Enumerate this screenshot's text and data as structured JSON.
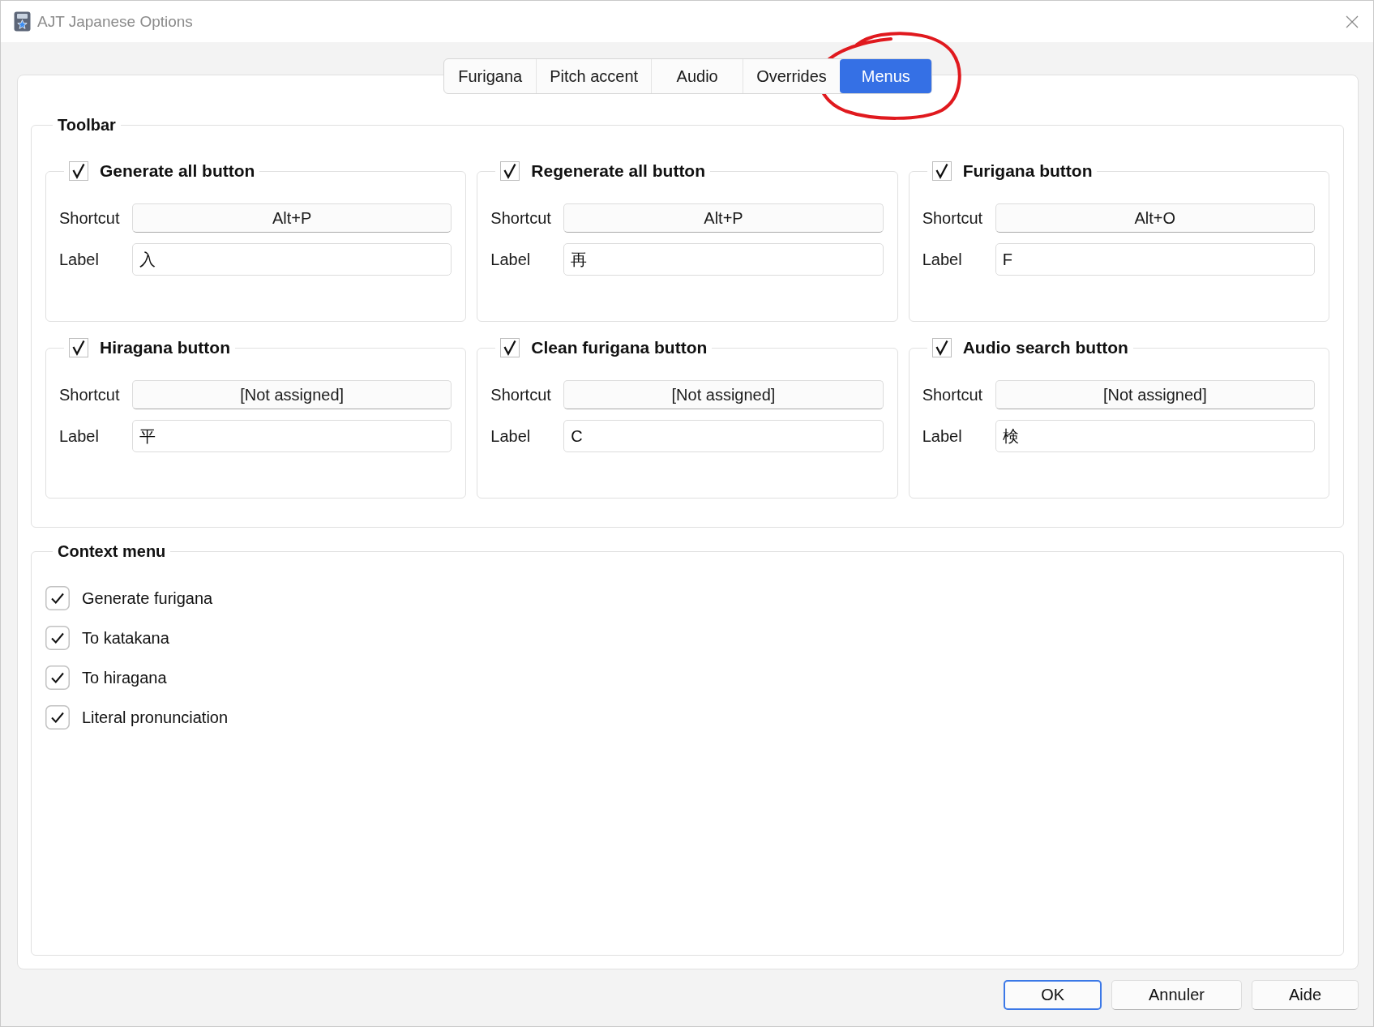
{
  "window": {
    "title": "AJT Japanese Options"
  },
  "tabs": [
    {
      "label": "Furigana",
      "selected": false
    },
    {
      "label": "Pitch accent",
      "selected": false
    },
    {
      "label": "Audio",
      "selected": false
    },
    {
      "label": "Overrides",
      "selected": false
    },
    {
      "label": "Menus",
      "selected": true
    }
  ],
  "toolbar": {
    "title": "Toolbar",
    "buttons": [
      {
        "title": "Generate all button",
        "checked": true,
        "shortcut_caption": "Shortcut",
        "shortcut": "Alt+P",
        "label_caption": "Label",
        "label": "入"
      },
      {
        "title": "Regenerate all button",
        "checked": true,
        "shortcut_caption": "Shortcut",
        "shortcut": "Alt+P",
        "label_caption": "Label",
        "label": "再"
      },
      {
        "title": "Furigana button",
        "checked": true,
        "shortcut_caption": "Shortcut",
        "shortcut": "Alt+O",
        "label_caption": "Label",
        "label": "F"
      },
      {
        "title": "Hiragana button",
        "checked": true,
        "shortcut_caption": "Shortcut",
        "shortcut": "[Not assigned]",
        "label_caption": "Label",
        "label": "平"
      },
      {
        "title": "Clean furigana button",
        "checked": true,
        "shortcut_caption": "Shortcut",
        "shortcut": "[Not assigned]",
        "label_caption": "Label",
        "label": "C"
      },
      {
        "title": "Audio search button",
        "checked": true,
        "shortcut_caption": "Shortcut",
        "shortcut": "[Not assigned]",
        "label_caption": "Label",
        "label": "検"
      }
    ]
  },
  "context_menu": {
    "title": "Context menu",
    "items": [
      {
        "label": "Generate furigana",
        "checked": true
      },
      {
        "label": "To katakana",
        "checked": true
      },
      {
        "label": "To hiragana",
        "checked": true
      },
      {
        "label": "Literal pronunciation",
        "checked": true
      }
    ]
  },
  "buttons": [
    {
      "label": "OK",
      "default": true
    },
    {
      "label": "Annuler",
      "default": false
    },
    {
      "label": "Aide",
      "default": false
    }
  ]
}
